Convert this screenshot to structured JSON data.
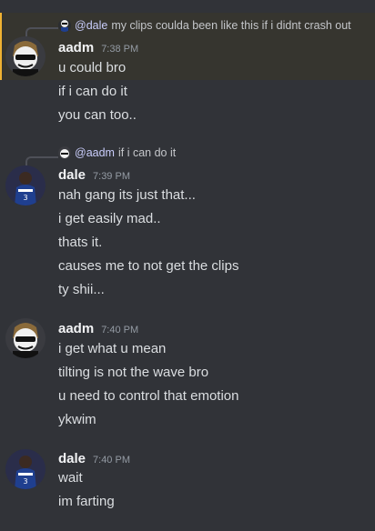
{
  "messages": [
    {
      "reply": {
        "mention": "@dale",
        "text": "my clips coulda been like this if i didnt crash out"
      },
      "author": "aadm",
      "time": "7:38 PM",
      "lines": [
        "u could bro",
        "if i can do it",
        "you can too.."
      ]
    },
    {
      "reply": {
        "mention": "@aadm",
        "text": "if i can do it"
      },
      "author": "dale",
      "time": "7:39 PM",
      "lines": [
        "nah gang its just that...",
        "i get easily mad..",
        "thats it.",
        "causes me to not get the clips",
        "ty shii..."
      ]
    },
    {
      "author": "aadm",
      "time": "7:40 PM",
      "lines": [
        "i get what u mean",
        "tilting is not the wave bro",
        "u need to control that emotion",
        "ykwim"
      ]
    },
    {
      "author": "dale",
      "time": "7:40 PM",
      "lines": [
        "wait",
        "im farting"
      ]
    }
  ],
  "colors": {
    "background": "#313338",
    "highlight": "#36352f",
    "highlight_bar": "#f0b232",
    "mention": "#c9cdfb"
  }
}
